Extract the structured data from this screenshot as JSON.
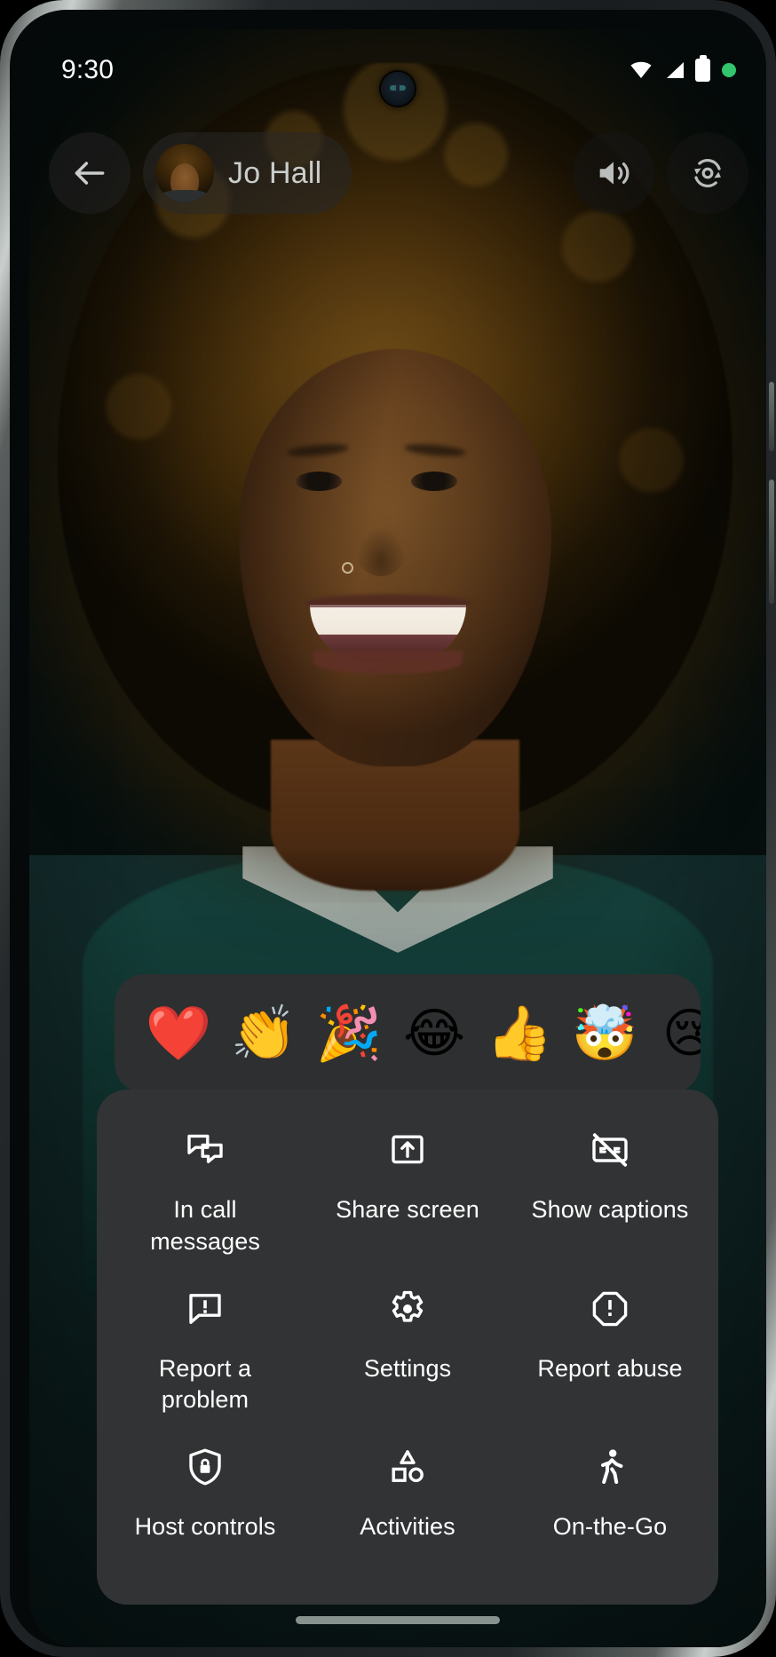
{
  "status_bar": {
    "time": "9:30",
    "icons": [
      {
        "name": "wifi-icon",
        "label": "Wi-Fi"
      },
      {
        "name": "cellular-signal-icon",
        "label": "Cellular signal"
      },
      {
        "name": "battery-icon",
        "label": "Battery"
      },
      {
        "name": "camera-active-indicator",
        "label": "Camera in use",
        "color": "#32c56e"
      }
    ]
  },
  "top_bar": {
    "back_button": {
      "name": "back-arrow-icon",
      "label": "Back"
    },
    "participant": {
      "name": "Jo Hall",
      "avatar_label": "Jo Hall avatar"
    },
    "speaker_button": {
      "name": "speaker-icon",
      "label": "Speaker"
    },
    "flip_camera_button": {
      "name": "flip-camera-icon",
      "label": "Flip camera"
    }
  },
  "reactions": {
    "items": [
      {
        "emoji": "❤️",
        "name": "reaction-heart"
      },
      {
        "emoji": "👏",
        "name": "reaction-clap"
      },
      {
        "emoji": "🎉",
        "name": "reaction-party-popper"
      },
      {
        "emoji": "😂",
        "name": "reaction-joy"
      },
      {
        "emoji": "👍",
        "name": "reaction-thumbs-up"
      },
      {
        "emoji": "🤯",
        "name": "reaction-mind-blown"
      },
      {
        "emoji": "😢",
        "name": "reaction-crying"
      }
    ]
  },
  "menu": {
    "items": [
      {
        "label": "In call messages",
        "icon": "chat-bubbles-icon"
      },
      {
        "label": "Share screen",
        "icon": "share-screen-icon"
      },
      {
        "label": "Show captions",
        "icon": "captions-off-icon"
      },
      {
        "label": "Report a problem",
        "icon": "report-problem-icon"
      },
      {
        "label": "Settings",
        "icon": "gear-icon"
      },
      {
        "label": "Report abuse",
        "icon": "report-abuse-icon"
      },
      {
        "label": "Host controls",
        "icon": "shield-lock-icon"
      },
      {
        "label": "Activities",
        "icon": "shapes-icon"
      },
      {
        "label": "On-the-Go",
        "icon": "walking-person-icon"
      }
    ]
  },
  "colors": {
    "panel_bg": "#323334",
    "reactions_bg": "#2e2f30",
    "text": "#ffffff",
    "name_text": "#c9cdcc",
    "indicator_green": "#32c56e"
  }
}
